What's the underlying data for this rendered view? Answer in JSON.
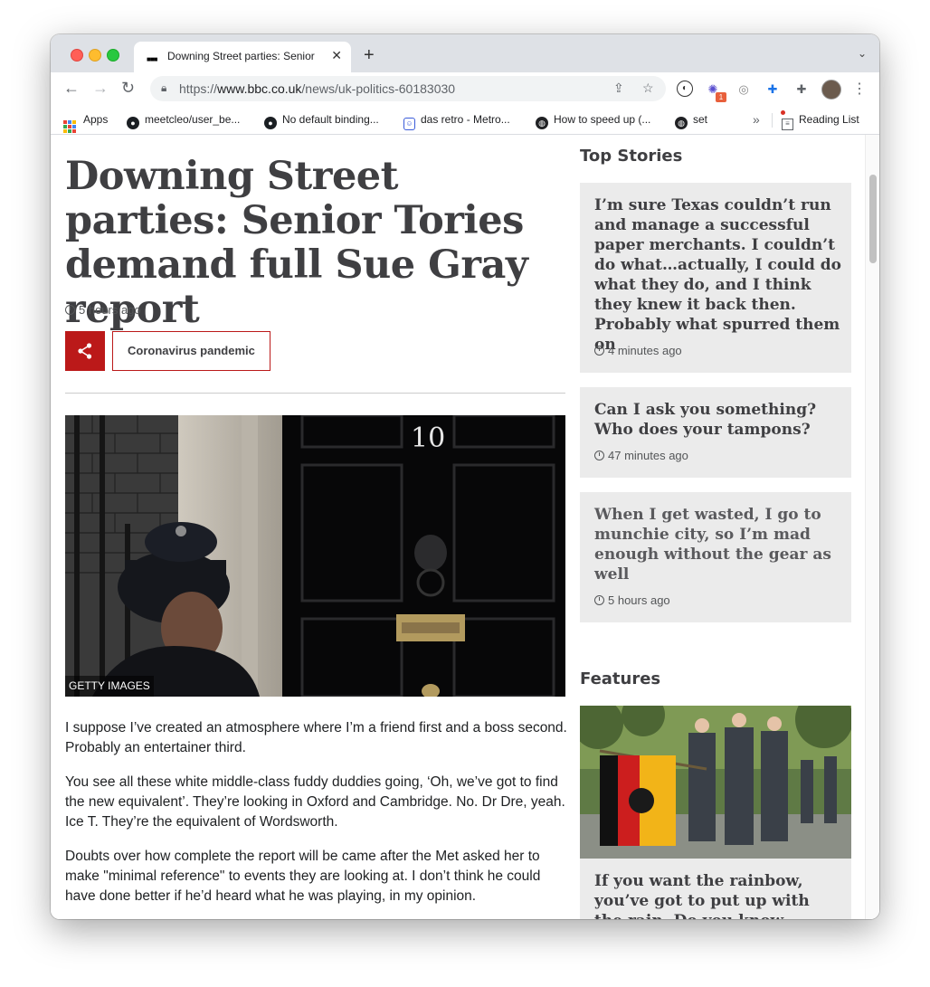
{
  "browser": {
    "tab_title": "Downing Street parties: Senior",
    "url_prefix": "https://",
    "url_domain": "www.bbc.co.uk",
    "url_path": "/news/uk-politics-60183030",
    "extension_badge": "1",
    "bookmarks": [
      {
        "label": "Apps",
        "icon": "apps-grid-icon"
      },
      {
        "label": "meetcleo/user_be...",
        "icon": "github-icon"
      },
      {
        "label": "No default binding...",
        "icon": "github-icon"
      },
      {
        "label": "das retro - Metro...",
        "icon": "retro-icon"
      },
      {
        "label": "How to speed up (...",
        "icon": "globe-icon"
      },
      {
        "label": "set",
        "icon": "globe-icon"
      }
    ],
    "reading_list": "Reading List"
  },
  "article": {
    "headline": "Downing Street parties: Senior Tories demand full Sue Gray report",
    "timestamp": "5 hours ago",
    "topic": "Coronavirus pandemic",
    "image_credit": "GETTY IMAGES",
    "door_number": "10",
    "paragraphs": [
      "I suppose I’ve created an atmosphere where I’m a friend first and a boss second. Probably an entertainer third.",
      "You see all these white middle-class fuddy duddies going, ‘Oh, we’ve got to find the new equivalent’. They’re looking in Oxford and Cambridge. No. Dr Dre, yeah. Ice T. They’re the equivalent of Wordsworth.",
      "Doubts over how complete the report will be came after the Met asked her to make \"minimal reference\" to events they are looking at. I don’t think he could have done better if he’d heard what he was playing, in my opinion."
    ]
  },
  "sidebar": {
    "top_stories_title": "Top Stories",
    "stories": [
      {
        "text": "I’m sure Texas couldn’t run and manage a successful paper merchants. I couldn’t do what…actually, I could do what they do, and I think they knew it back then. Probably what spurred them on",
        "time": "4 minutes ago"
      },
      {
        "text": "Can I ask you something? Who does your tampons?",
        "time": "47 minutes ago"
      },
      {
        "text": "When I get wasted, I go to munchie city, so I’m mad enough without the gear as well",
        "time": "5 hours ago"
      }
    ],
    "features_title": "Features",
    "feature_text": "If you want the rainbow, you’ve got to put up with the rain. Do you know which"
  },
  "colors": {
    "bbc_red": "#bb1919",
    "card_bg": "#ebebeb",
    "headline": "#3f3f42"
  }
}
